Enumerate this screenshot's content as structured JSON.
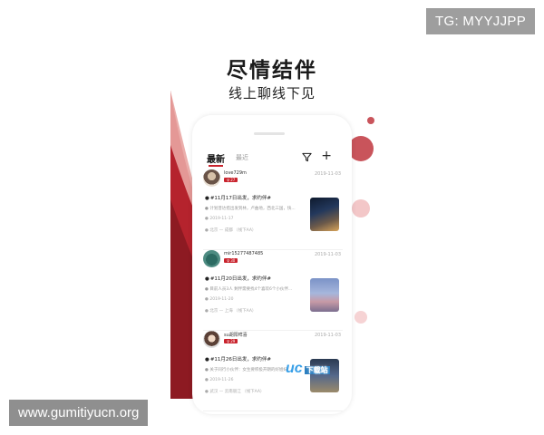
{
  "watermark": {
    "tg": "TG: MYYJJPP",
    "site": "www.gumitiyucn.org",
    "app_logo": "uc",
    "app_logo_sub": "下载站"
  },
  "promo": {
    "headline": "尽情结伴",
    "subline": "线上聊线下见"
  },
  "app": {
    "tabs": [
      {
        "label": "最新",
        "active": true
      },
      {
        "label": "最近",
        "active": false
      }
    ],
    "icons": {
      "filter": "filter-icon",
      "add": "+"
    },
    "accent": "#c9232d"
  },
  "posts": [
    {
      "username": "love729m",
      "age": "♀ 27",
      "date": "2019-11-03",
      "title": "#11月17日出发，求约伴#",
      "desc": "计划普达措出发到林，卢曲地，西北三国，快...",
      "time": "2019-11-17",
      "route": "北京 — 成都 （线下AA）"
    },
    {
      "username": "mir15277487485",
      "age": "♀ 30",
      "date": "2019-11-03",
      "title": "#11月20日出发，求约伴#",
      "desc": "目前人员3人 剩伴需要找4个喜欢6个小伙伴...",
      "time": "2019-11-20",
      "route": "北京 — 上海 （线下AA）"
    },
    {
      "username": "su胡阳咩喜",
      "age": "♀ 29",
      "date": "2019-11-03",
      "title": "#11月26日出发，求约伴#",
      "desc": "关于同行小伙伴：女生要积极开朗的好姐妹",
      "time": "2019-11-26",
      "route": "武汉 — 云南丽江 （线下AA）"
    }
  ]
}
